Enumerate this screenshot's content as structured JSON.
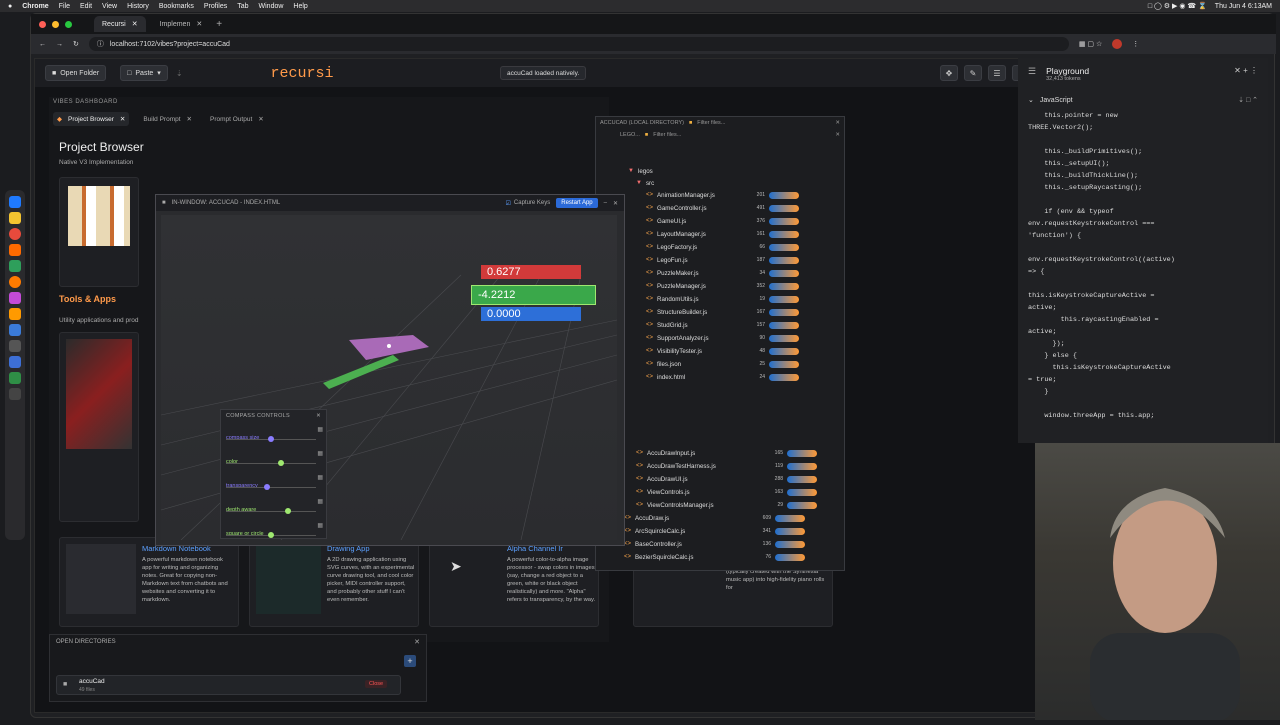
{
  "menubar": {
    "apple": "",
    "app": "Chrome",
    "items": [
      "File",
      "Edit",
      "View",
      "History",
      "Bookmarks",
      "Profiles",
      "Tab",
      "Window",
      "Help"
    ],
    "datetime": "Thu Jun 4  6:13AM"
  },
  "browser": {
    "tabs": [
      {
        "label": "Recursi",
        "active": true
      },
      {
        "label": "Implemen",
        "active": false
      }
    ],
    "url": "localhost:7102/vibes?project=accuCad"
  },
  "toolbar": {
    "open_folder": "Open Folder",
    "paste": "Paste",
    "brand": "recursi",
    "status": "accuCad loaded natively."
  },
  "dashboard": {
    "label": "VIBES DASHBOARD",
    "tabs": [
      "Project Browser",
      "Build Prompt",
      "Prompt Output"
    ],
    "title": "Project Browser",
    "subtitle": "Native V3 Implementation",
    "tools_title": "Tools & Apps",
    "tools_subtitle": "Utility applications and prod",
    "cards": [
      {
        "title": "Markdown Notebook",
        "text": "A powerful markdown notebook app for writing and organizing notes. Great for copying non-Markdown text from chatbots and websites and converting it to markdown."
      },
      {
        "title": "Drawing App",
        "text": "A 2D drawing application using SVG curves, with an experimental curve drawing tool, and cool color picker, MIDI controller support, and probably other stuff I can't even remember."
      },
      {
        "title": "Alpha Channel Ir",
        "text": "A powerful color-to-alpha image processor - swap colors in images (say, change a red object to a green, white or black object realistically) and more. \"Alpha\" refers to transparency, by the way."
      },
      {
        "title": "",
        "text": "Scrapes MIDI data (yes, a simplified subset of MIDI) out of piano tutorial animations from YouTube videos (typically created with the Synthesia music app) into high-fidelity piano rolls for"
      }
    ]
  },
  "viewport": {
    "title": "IN-WINDOW: ACCUCAD - INDEX.HTML",
    "capture_label": "Capture Keys",
    "restart": "Restart App",
    "values": [
      "0.6277",
      "-4.2212",
      "0.0000"
    ]
  },
  "compass": {
    "title": "COMPASS CONTROLS",
    "rows": [
      {
        "label": "compass size",
        "color": "#8a7cff",
        "level": 0.5
      },
      {
        "label": "color",
        "color": "#9fe870",
        "level": 0.62
      },
      {
        "label": "transparency",
        "color": "#8a7cff",
        "level": 0.45
      },
      {
        "label": "depth aware",
        "color": "#9fe870",
        "level": 0.7
      },
      {
        "label": "square or circle",
        "color": "#9fe870",
        "level": 0.5
      }
    ]
  },
  "tree": {
    "outer_title": "ACCUCAD (LOCAL DIRECTORY)",
    "inner_title": "LEGO...",
    "filter_placeholder": "Filter files...",
    "folders": [
      "legos",
      "src"
    ],
    "files": [
      {
        "name": "AnimationManager.js",
        "count": "201"
      },
      {
        "name": "GameController.js",
        "count": "491"
      },
      {
        "name": "GameUI.js",
        "count": "376"
      },
      {
        "name": "LayoutManager.js",
        "count": "161"
      },
      {
        "name": "LegoFactory.js",
        "count": "66"
      },
      {
        "name": "LegoFun.js",
        "count": "187"
      },
      {
        "name": "PuzzleMaker.js",
        "count": "34"
      },
      {
        "name": "PuzzleManager.js",
        "count": "352"
      },
      {
        "name": "RandomUtils.js",
        "count": "19"
      },
      {
        "name": "StructureBuilder.js",
        "count": "167"
      },
      {
        "name": "StudGrid.js",
        "count": "157"
      },
      {
        "name": "SupportAnalyzer.js",
        "count": "90"
      },
      {
        "name": "VisibilityTester.js",
        "count": "48"
      },
      {
        "name": "files.json",
        "count": "25"
      },
      {
        "name": "index.html",
        "count": "24"
      }
    ],
    "lower_files": [
      {
        "name": "AccuDrawInput.js",
        "count": "165"
      },
      {
        "name": "AccuDrawTestHarness.js",
        "count": "119"
      },
      {
        "name": "AccuDrawUI.js",
        "count": "288"
      },
      {
        "name": "ViewControls.js",
        "count": "163"
      },
      {
        "name": "ViewControlsManager.js",
        "count": "29"
      },
      {
        "name": "AccuDraw.js",
        "count": "609"
      },
      {
        "name": "ArcSquircleCalc.js",
        "count": "341"
      },
      {
        "name": "BaseController.js",
        "count": "136"
      },
      {
        "name": "BezierSquircleCalc.js",
        "count": "76"
      }
    ]
  },
  "open_dirs": {
    "title": "OPEN DIRECTORIES",
    "item_name": "accuCad",
    "item_meta": "49 files",
    "close": "Close"
  },
  "playground": {
    "title": "Playground",
    "tokens": "32,413 tokens",
    "language": "JavaScript",
    "code": [
      "    this.pointer = new",
      "THREE.Vector2();",
      "",
      "    this._buildPrimitives();",
      "    this._setupUI();",
      "    this._buildThickLine();",
      "    this._setupRaycasting();",
      "",
      "    if (env && typeof",
      "env.requestKeystrokeControl ===",
      "'function') {",
      "",
      "env.requestKeystrokeControl((active)",
      "=> {",
      "",
      "this.isKeystrokeCaptureActive =",
      "active;",
      "        this.raycastingEnabled =",
      "active;",
      "      });",
      "    } else {",
      "      this.isKeystrokeCaptureActive",
      "= true;",
      "    }",
      "",
      "    window.threeApp = this.app;"
    ]
  }
}
